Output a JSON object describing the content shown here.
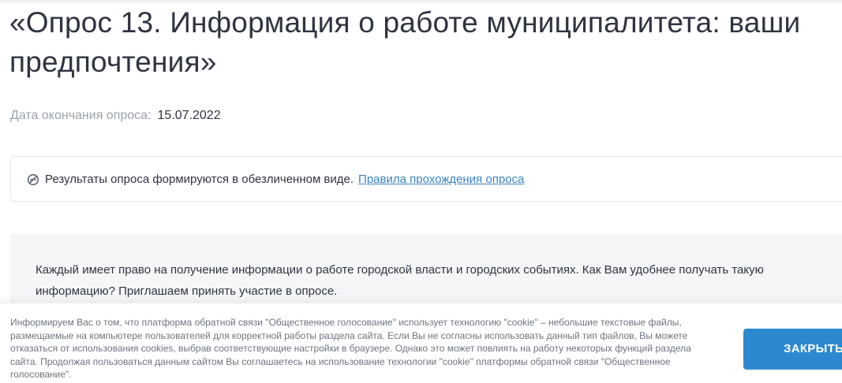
{
  "survey": {
    "title": "«Опрос 13. Информация о работе муниципалитета: ваши предпочтения»",
    "deadline_label": "Дата окончания опроса:",
    "deadline_value": "15.07.2022"
  },
  "notice": {
    "icon": "anonymous-icon",
    "text": "Результаты опроса формируются в обезличенном виде.",
    "rules_link": "Правила прохождения опроса"
  },
  "description": {
    "text": "Каждый имеет право на получение информации о работе городской власти и городских событиях. Как Вам удобнее получать такую информацию? Приглашаем принять участие в опросе."
  },
  "cookie_banner": {
    "text": "Информируем Вас о том, что платформа обратной связи \"Общественное голосование\" использует технологию \"cookie\" – небольшие текстовые файлы, размещаемые на компьютере пользователей для корректной работы раздела сайта. Если Вы не согласны использовать данный тип файлов, Вы можете отказаться от использования cookies, выбрав соответствующие настройки в браузере. Однако это может повлиять на работу некоторых функций раздела сайта. Продолжая пользоваться данным сайтом Вы соглашаетесь на использование технологии \"cookie\" платформы обратной связи \"Общественное голосование\".",
    "close_label": "ЗАКРЫТЬ"
  },
  "colors": {
    "accent": "#2d89cf",
    "link": "#3b82bd",
    "text": "#2f3441",
    "muted": "#9aa1aa"
  }
}
